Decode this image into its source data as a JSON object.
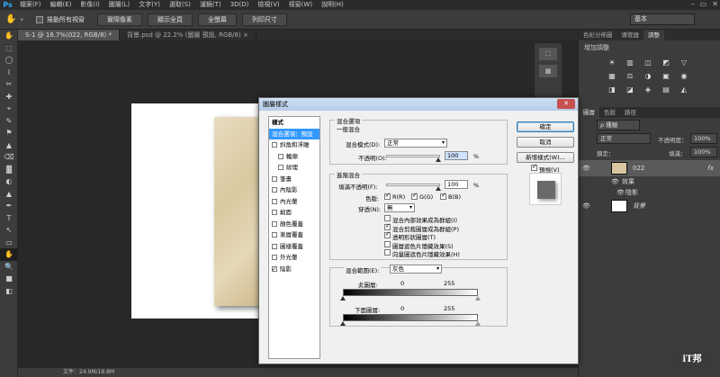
{
  "app": {
    "logo": "Ps"
  },
  "menubar": [
    "檔案(F)",
    "編輯(E)",
    "影像(I)",
    "圖層(L)",
    "文字(Y)",
    "選取(S)",
    "濾鏡(T)",
    "3D(D)",
    "檢視(V)",
    "視窗(W)",
    "說明(H)"
  ],
  "window_controls": [
    "–",
    "▭",
    "✕"
  ],
  "options": {
    "scroll_all": "捲動所有視窗",
    "btn1": "實際像素",
    "btn2": "顯示全頁",
    "btn3": "全螢幕",
    "btn4": "列印尺寸",
    "workspace": "基本"
  },
  "tabs": [
    "S-1 @ 16.7%(022, RGB/8) *",
    "背景.psd @ 22.2% (圖層 預設, RGB/8) ×"
  ],
  "tools": [
    "✋",
    "⬚",
    "◯",
    "⌇",
    "✂",
    "✚",
    "⌖",
    "✎",
    "⚑",
    "▲",
    "⌫",
    "▓",
    "◐",
    "▲",
    "✒",
    "T",
    "↖",
    "▭",
    "✋",
    "🔍",
    "■",
    "◧"
  ],
  "statusbar": {
    "text": "文件：24.9M/18.8M"
  },
  "panels": {
    "adj_tabs": [
      "色彩分佈圖",
      "導覽器",
      "調整"
    ],
    "adj_title": "增加調整",
    "adj_icons": [
      "☀",
      "▥",
      "◫",
      "◩",
      "▽",
      "▦",
      "⚖",
      "◑",
      "▣",
      "◉",
      "◨",
      "◪",
      "◈",
      "▤",
      "◭"
    ],
    "layer_tabs": [
      "圖層",
      "色版",
      "路徑"
    ],
    "kind": "ρ 種類",
    "blend": "正常",
    "opacity_label": "不透明度：",
    "opacity": "100%",
    "lock_label": "鎖定：",
    "fill_label": "填滿：",
    "fill": "100%",
    "layers": [
      {
        "name": "022",
        "fx": "fx"
      },
      {
        "name": "效果"
      },
      {
        "name": "陰影"
      },
      {
        "name": "背景"
      }
    ]
  },
  "dialog": {
    "title": "圖層樣式",
    "close": "✕",
    "styles_header": "樣式",
    "styles": [
      {
        "label": "混合選項：預設",
        "checkbox": false,
        "sel": true,
        "indent": false
      },
      {
        "label": "斜角和浮雕",
        "checkbox": true,
        "on": false,
        "indent": false
      },
      {
        "label": "輪廓",
        "checkbox": true,
        "on": false,
        "indent": true
      },
      {
        "label": "紋理",
        "checkbox": true,
        "on": false,
        "indent": true
      },
      {
        "label": "筆畫",
        "checkbox": true,
        "on": false,
        "indent": false
      },
      {
        "label": "內陰影",
        "checkbox": true,
        "on": false,
        "indent": false
      },
      {
        "label": "內光暈",
        "checkbox": true,
        "on": false,
        "indent": false
      },
      {
        "label": "緞面",
        "checkbox": true,
        "on": false,
        "indent": false
      },
      {
        "label": "顏色覆蓋",
        "checkbox": true,
        "on": false,
        "indent": false
      },
      {
        "label": "漸層覆蓋",
        "checkbox": true,
        "on": false,
        "indent": false
      },
      {
        "label": "圖樣覆蓋",
        "checkbox": true,
        "on": false,
        "indent": false
      },
      {
        "label": "外光暈",
        "checkbox": true,
        "on": false,
        "indent": false
      },
      {
        "label": "陰影",
        "checkbox": true,
        "on": true,
        "indent": false
      }
    ],
    "blend_options": "混合選項",
    "general": "一般混合",
    "blend_mode_label": "混合模式(D):",
    "blend_mode": "正常",
    "opacity_label": "不透明(O):",
    "opacity": "100",
    "pct": "%",
    "advanced": "進階混合",
    "fill_label": "填滿不透明(F):",
    "fill": "100",
    "channels_label": "色版:",
    "ch_r": "R(R)",
    "ch_g": "G(G)",
    "ch_b": "B(B)",
    "knockout_label": "穿透(N):",
    "knockout": "無",
    "opts": [
      {
        "label": "混合內部效果成為群組(I)",
        "on": false
      },
      {
        "label": "混合剪裁圖層成為群組(P)",
        "on": true
      },
      {
        "label": "透明形狀圖層(T)",
        "on": true
      },
      {
        "label": "圖層遮色片隱藏效果(S)",
        "on": false
      },
      {
        "label": "向量圖遮色片隱藏效果(H)",
        "on": false
      }
    ],
    "blend_if_label": "混合範圍(E):",
    "blend_if": "灰色",
    "this_layer": "此圖層:",
    "underlying": "下面圖層:",
    "v0": "0",
    "v255": "255",
    "ok": "確定",
    "cancel": "取消",
    "new_style": "新增樣式(W)...",
    "preview": "預視(V)"
  },
  "watermark": "iT邦"
}
